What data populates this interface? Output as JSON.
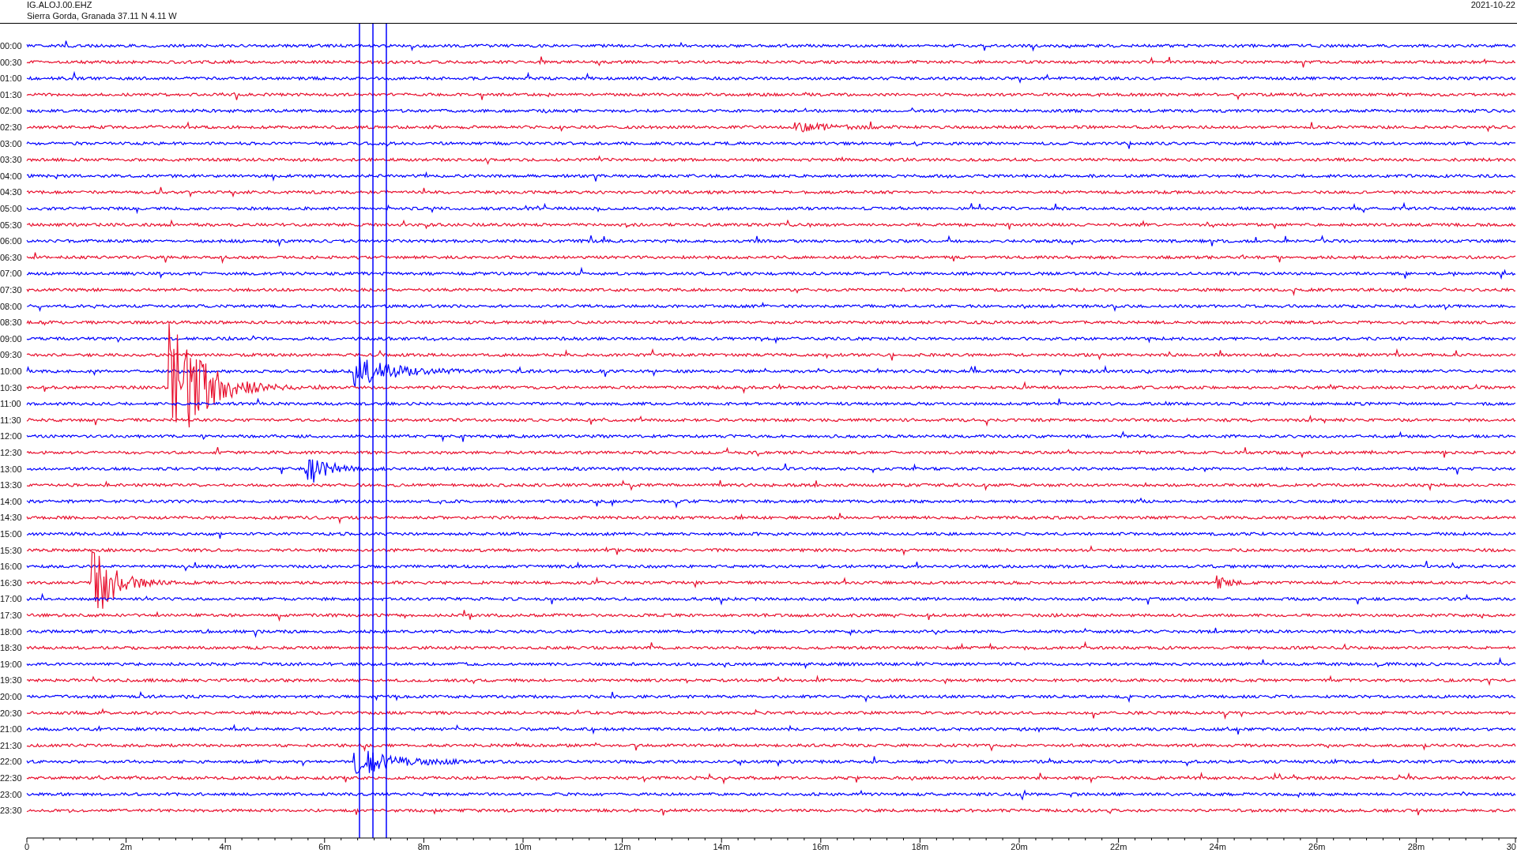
{
  "header": {
    "station": "IG.ALOJ.00.EHZ",
    "location": "Sierra Gorda, Granada  37.11 N 4.11 W",
    "date": "2021-10-22"
  },
  "traces": [
    {
      "label": "00:00",
      "color": "#0000ff"
    },
    {
      "label": "00:30",
      "color": "#e8102e"
    },
    {
      "label": "01:00",
      "color": "#0000ff"
    },
    {
      "label": "01:30",
      "color": "#e8102e"
    },
    {
      "label": "02:00",
      "color": "#0000ff"
    },
    {
      "label": "02:30",
      "color": "#e8102e"
    },
    {
      "label": "03:00",
      "color": "#0000ff"
    },
    {
      "label": "03:30",
      "color": "#e8102e"
    },
    {
      "label": "04:00",
      "color": "#0000ff"
    },
    {
      "label": "04:30",
      "color": "#e8102e"
    },
    {
      "label": "05:00",
      "color": "#0000ff"
    },
    {
      "label": "05:30",
      "color": "#e8102e"
    },
    {
      "label": "06:00",
      "color": "#0000ff"
    },
    {
      "label": "06:30",
      "color": "#e8102e"
    },
    {
      "label": "07:00",
      "color": "#0000ff"
    },
    {
      "label": "07:30",
      "color": "#e8102e"
    },
    {
      "label": "08:00",
      "color": "#0000ff"
    },
    {
      "label": "08:30",
      "color": "#e8102e"
    },
    {
      "label": "09:00",
      "color": "#0000ff"
    },
    {
      "label": "09:30",
      "color": "#e8102e"
    },
    {
      "label": "10:00",
      "color": "#0000ff"
    },
    {
      "label": "10:30",
      "color": "#e8102e"
    },
    {
      "label": "11:00",
      "color": "#0000ff"
    },
    {
      "label": "11:30",
      "color": "#e8102e"
    },
    {
      "label": "12:00",
      "color": "#0000ff"
    },
    {
      "label": "12:30",
      "color": "#e8102e"
    },
    {
      "label": "13:00",
      "color": "#0000ff"
    },
    {
      "label": "13:30",
      "color": "#e8102e"
    },
    {
      "label": "14:00",
      "color": "#0000ff"
    },
    {
      "label": "14:30",
      "color": "#e8102e"
    },
    {
      "label": "15:00",
      "color": "#0000ff"
    },
    {
      "label": "15:30",
      "color": "#e8102e"
    },
    {
      "label": "16:00",
      "color": "#0000ff"
    },
    {
      "label": "16:30",
      "color": "#e8102e"
    },
    {
      "label": "17:00",
      "color": "#0000ff"
    },
    {
      "label": "17:30",
      "color": "#e8102e"
    },
    {
      "label": "18:00",
      "color": "#0000ff"
    },
    {
      "label": "18:30",
      "color": "#e8102e"
    },
    {
      "label": "19:00",
      "color": "#0000ff"
    },
    {
      "label": "19:30",
      "color": "#e8102e"
    },
    {
      "label": "20:00",
      "color": "#0000ff"
    },
    {
      "label": "20:30",
      "color": "#e8102e"
    },
    {
      "label": "21:00",
      "color": "#0000ff"
    },
    {
      "label": "21:30",
      "color": "#e8102e"
    },
    {
      "label": "22:00",
      "color": "#0000ff"
    },
    {
      "label": "22:30",
      "color": "#e8102e"
    },
    {
      "label": "23:00",
      "color": "#0000ff"
    },
    {
      "label": "23:30",
      "color": "#e8102e"
    }
  ],
  "axis": {
    "labels": [
      "0",
      "2m",
      "4m",
      "6m",
      "8m",
      "10m",
      "12m",
      "14m",
      "16m",
      "18m",
      "20m",
      "22m",
      "24m",
      "26m",
      "28m",
      "30"
    ]
  }
}
